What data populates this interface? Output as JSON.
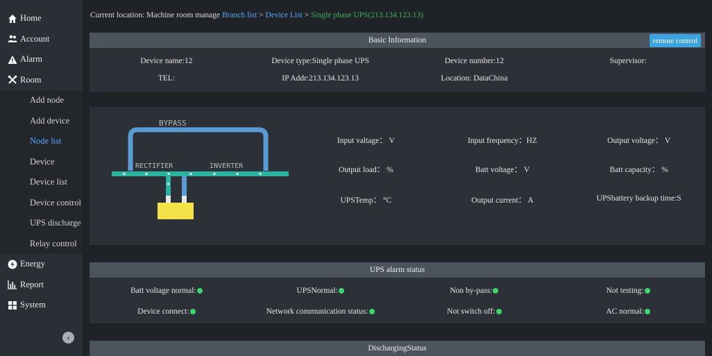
{
  "sidebar": {
    "items": [
      {
        "label": "Home",
        "icon": "home-icon"
      },
      {
        "label": "Account",
        "icon": "users-icon"
      },
      {
        "label": "Alarm",
        "icon": "warning-icon"
      },
      {
        "label": "Room",
        "icon": "tools-icon"
      }
    ],
    "sub_items": [
      "Add node",
      "Add device",
      "Node list",
      "Device",
      "Device list",
      "Device control",
      "UPS discharge",
      "Relay control"
    ],
    "active_sub": "Node list",
    "bottom_items": [
      {
        "label": "Energy",
        "icon": "lightning-icon"
      },
      {
        "label": "Report",
        "icon": "chart-icon"
      },
      {
        "label": "System",
        "icon": "grid-icon"
      }
    ]
  },
  "breadcrumb": {
    "prefix": "Current location: Machine room manage ",
    "branch": "Branch list",
    "sep1": " > ",
    "device_list": "Device List",
    "sep2": " > ",
    "current": "Single phase UPS(213.134.123.13)"
  },
  "basic": {
    "title": "Basic Information",
    "remote_control": "remote control",
    "row1": [
      "Device name:12",
      "Device type:Single phase UPS",
      "Device number:12",
      "Supervisor:"
    ],
    "row2": [
      "TEL:",
      "IP Addr:213.134.123.13",
      "Location: DataChina",
      ""
    ]
  },
  "diagram": {
    "bypass": "BYPASS",
    "rectifier": "RECTIFIER",
    "inverter": "INVERTER"
  },
  "measurements": {
    "row1": [
      "Input valtage： V",
      "Input frequency：HZ",
      "Output voltage： V"
    ],
    "row2": [
      "Output load： %",
      "Batt voltage： V",
      "Batt capacity： %"
    ],
    "row3": [
      "UPSTemp： °C",
      "Output current： A",
      "UPSbattery backup time:S"
    ]
  },
  "alarm": {
    "title": "UPS alarm status",
    "row1": [
      "Batt voltage normal:",
      "UPSNormal:",
      "Non by-pass:",
      "Not testing:"
    ],
    "row2": [
      "Device connect:",
      "Network communication status:",
      "Not switch off:",
      "AC normal:"
    ]
  },
  "discharging": {
    "title": "DischargingStatus"
  },
  "colors": {
    "accent": "#3aa3e0",
    "active_link": "#5aa7ff",
    "status_ok": "#3cd66a",
    "breadcrumb_current": "#3fb05a"
  }
}
